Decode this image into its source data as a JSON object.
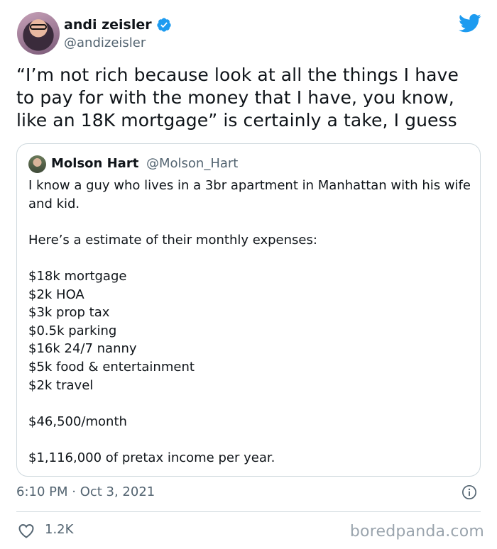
{
  "author": {
    "display_name": "andi zeisler",
    "handle": "@andizeisler"
  },
  "tweet": {
    "text": "“I’m not rich because look at all the things I have to pay for with the money that I have, you know, like an 18K mortgage” is certainly a take, I guess",
    "timestamp": "6:10 PM · Oct 3, 2021",
    "likes": "1.2K"
  },
  "quote": {
    "display_name": "Molson Hart",
    "handle": "@Molson_Hart",
    "lines": [
      "I know a guy who lives in a 3br apartment in Manhattan with his wife and kid.",
      "",
      "Here’s a estimate of their monthly expenses:",
      "",
      "$18k mortgage",
      "$2k HOA",
      "$3k prop tax",
      "$0.5k parking",
      "$16k 24/7 nanny",
      "$5k food & entertainment",
      "$2k travel",
      "",
      "$46,500/month",
      "",
      "$1,116,000 of pretax income per year."
    ]
  },
  "watermark": "boredpanda.com",
  "icons": {
    "verified": "verified-badge-icon",
    "twitter": "twitter-bird-icon",
    "info": "info-icon",
    "like": "heart-icon"
  },
  "colors": {
    "twitter_blue": "#1d9bf0",
    "secondary_text": "#536471",
    "border": "#cfd9de"
  }
}
